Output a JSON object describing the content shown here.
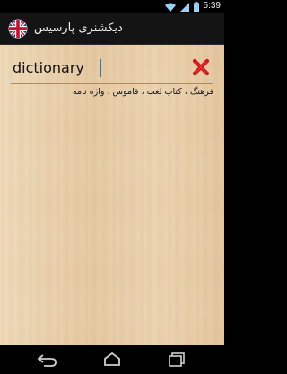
{
  "status_bar": {
    "time": "5:39",
    "icons": [
      "wifi-icon",
      "signal-icon",
      "battery-icon"
    ]
  },
  "action_bar": {
    "title": "دیکشنری پارسیس",
    "icon": "uk-flag-icon"
  },
  "search": {
    "value": "dictionary",
    "clear_icon": "close-icon",
    "accent_color": "#4fa3d6",
    "clear_color": "#d0151b"
  },
  "result": {
    "text": "فرهنگ ، کتاب لغت ، قاموس ، واژه نامه"
  },
  "nav_bar": {
    "icons": [
      "back-icon",
      "home-icon",
      "recent-apps-icon"
    ]
  }
}
